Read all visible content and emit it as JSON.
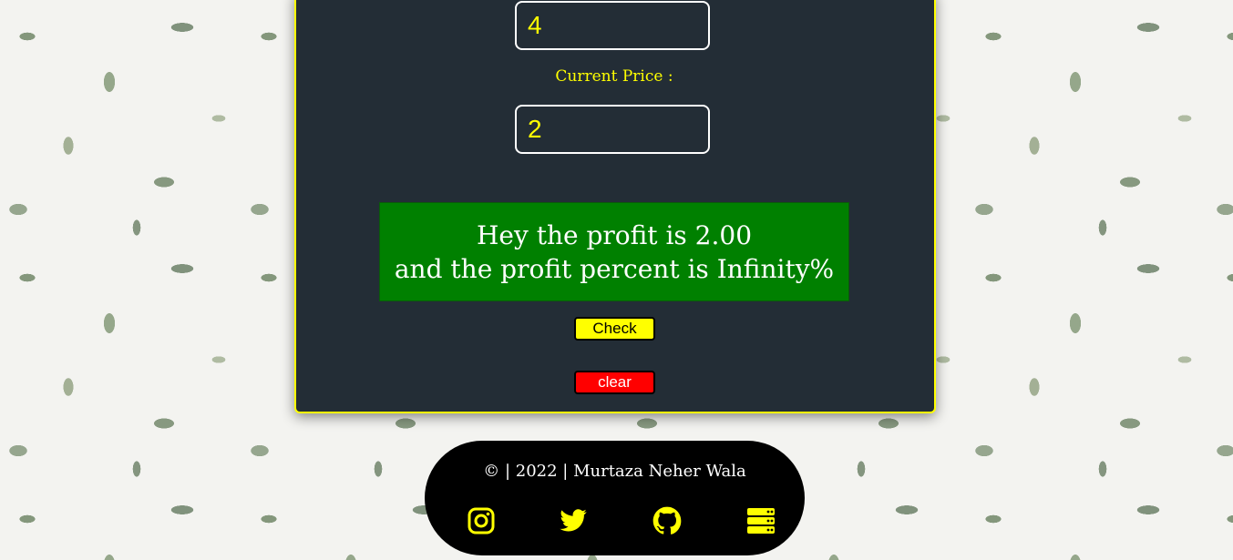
{
  "form": {
    "quantity_value": "4",
    "current_price_label": "Current Price :",
    "current_price_value": "2"
  },
  "result": {
    "line1": "Hey the profit is 2.00",
    "line2": "and the profit percent is Infinity%"
  },
  "buttons": {
    "check_label": "Check",
    "clear_label": "clear"
  },
  "footer": {
    "text": "© | 2022 | Murtaza Neher Wala",
    "links": [
      {
        "icon": "instagram-icon"
      },
      {
        "icon": "twitter-icon"
      },
      {
        "icon": "github-icon"
      },
      {
        "icon": "server-icon"
      }
    ]
  },
  "colors": {
    "card_bg": "#232d36",
    "accent_yellow": "#ffff00",
    "result_green": "#008000",
    "clear_red": "#ff0000",
    "footer_bg": "#000000"
  }
}
